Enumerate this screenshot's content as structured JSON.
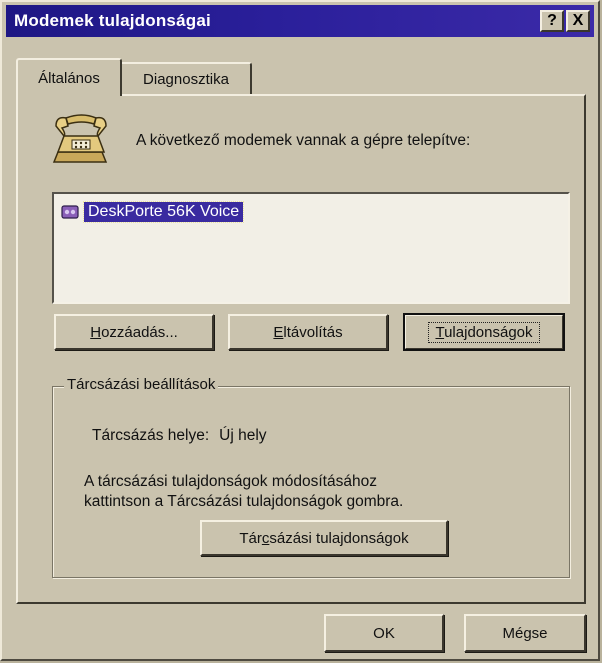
{
  "window": {
    "title": "Modemek tulajdonságai",
    "help_button": "?",
    "close_button": "X"
  },
  "tabs": [
    {
      "label": "Általános",
      "active": true
    },
    {
      "label": "Diagnosztika",
      "active": false
    }
  ],
  "general": {
    "installed_text": "A következő modemek vannak a gépre telepítve:",
    "modems": [
      {
        "name": "DeskPorte 56K Voice",
        "selected": true
      }
    ],
    "buttons": {
      "add": {
        "pre": "",
        "ul": "H",
        "post": "ozzáadás..."
      },
      "remove": {
        "pre": "",
        "ul": "E",
        "post": "ltávolítás"
      },
      "properties": {
        "pre": "",
        "ul": "T",
        "post": "ulajdonságok"
      }
    },
    "dialing": {
      "group_label": "Tárcsázási beállítások",
      "location_label": "Tárcsázás helye:",
      "location_value": "Új hely",
      "note_line1": "A tárcsázási tulajdonságok módosításához",
      "note_line2": "kattintson a Tárcsázási tulajdonságok gombra.",
      "button": {
        "pre": "Tár",
        "ul": "c",
        "post": "sázási tulajdonságok"
      }
    }
  },
  "footer": {
    "ok": "OK",
    "cancel": "Mégse"
  },
  "colors": {
    "titlebar": "#1e1784",
    "selection": "#3a2ba0",
    "face": "#cac3ae"
  }
}
